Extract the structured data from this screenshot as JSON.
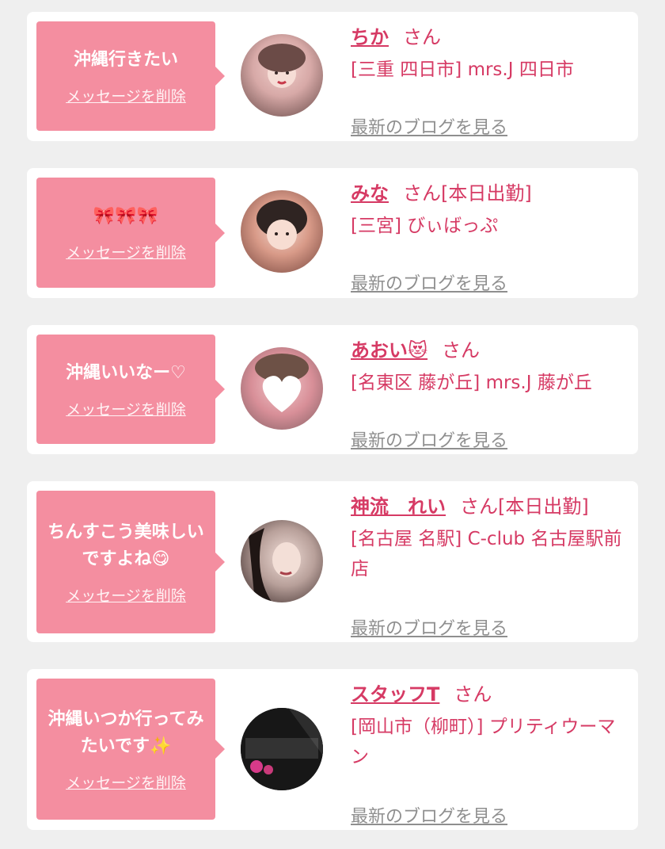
{
  "delete_label": "メッセージを削除",
  "blog_label": "最新のブログを見る",
  "san_label": "さん",
  "colors": {
    "bubble": "#f48ea0",
    "name": "#d63a64",
    "link_gray": "#8f8f8f",
    "card": "#ffffff",
    "bg": "#efefef"
  },
  "cards": [
    {
      "message": "沖縄行きたい",
      "name": "ちか",
      "status": "",
      "shop": "[三重 四日市] mrs.J 四日市"
    },
    {
      "message": "🎀🎀🎀",
      "name": "みな",
      "status": "[本日出勤]",
      "shop": "[三宮] びぃばっぷ"
    },
    {
      "message": "沖縄いいなー♡",
      "name": "あおい😻",
      "status": "",
      "shop": "[名東区 藤が丘] mrs.J 藤が丘"
    },
    {
      "message": "ちんすこう美味しいですよね😋",
      "name": "神流　れい",
      "status": "[本日出勤]",
      "shop": "[名古屋 名駅] C-club 名古屋駅前店"
    },
    {
      "message": "沖縄いつか行ってみたいです✨",
      "name": "スタッフT",
      "status": "",
      "shop": "[岡山市（柳町）] プリティウーマン"
    }
  ]
}
